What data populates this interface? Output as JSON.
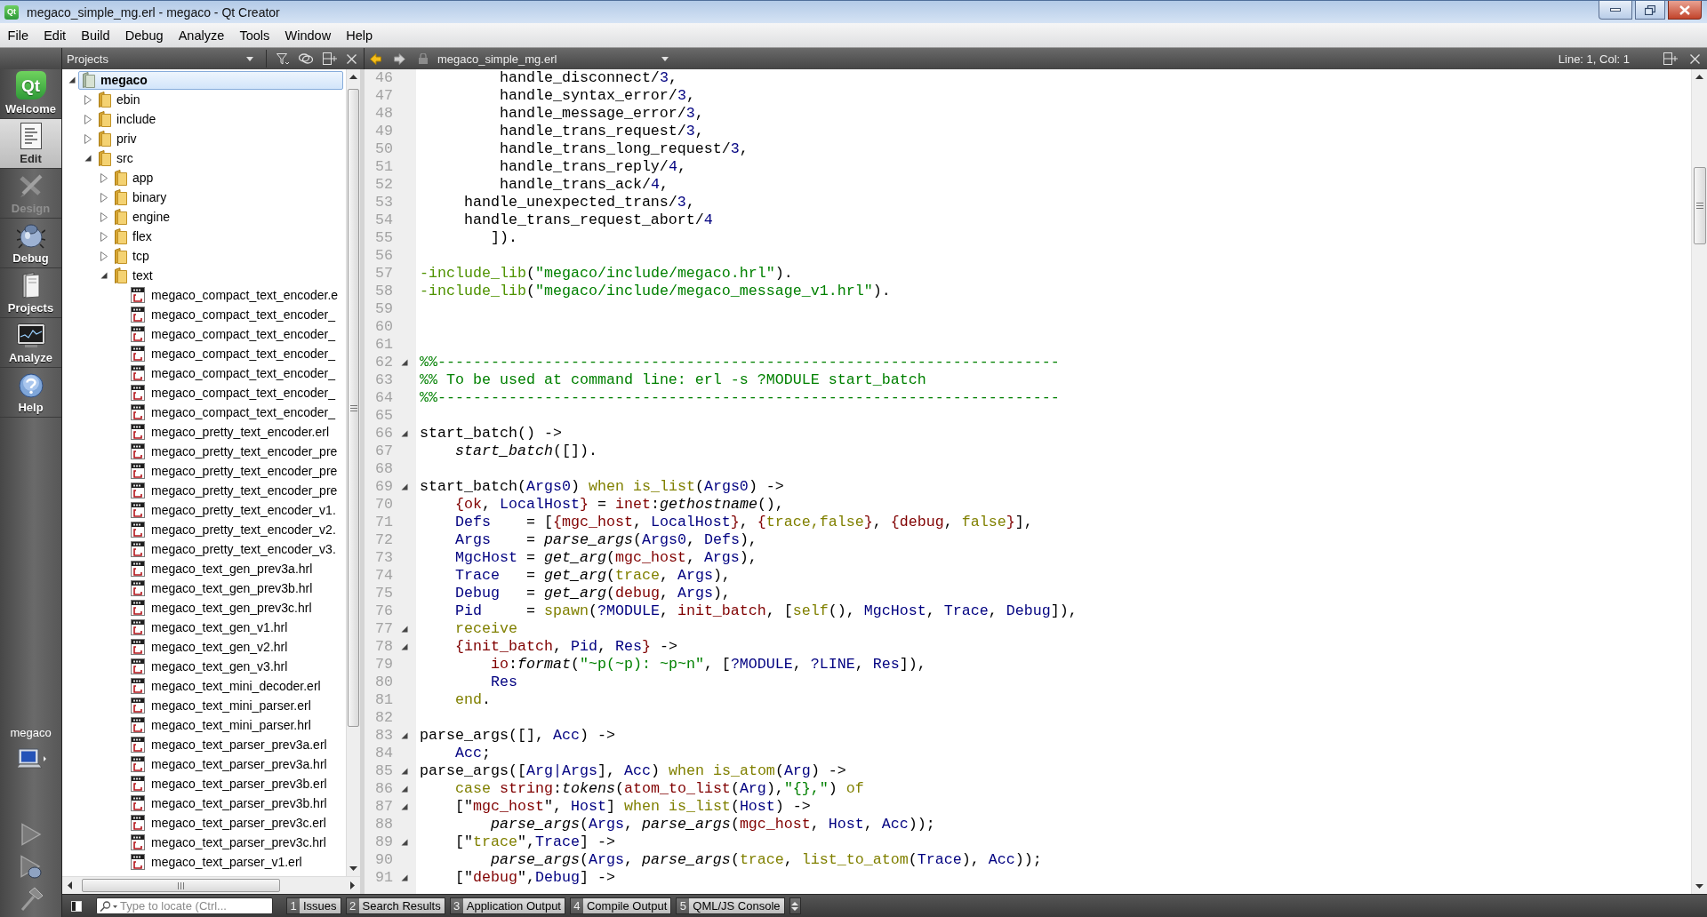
{
  "window": {
    "icon_text": "Qt",
    "title": "megaco_simple_mg.erl - megaco - Qt Creator"
  },
  "menu": [
    "File",
    "Edit",
    "Build",
    "Debug",
    "Analyze",
    "Tools",
    "Window",
    "Help"
  ],
  "modes": [
    {
      "kind": "welcome",
      "label": "Welcome",
      "logo_text": "Qt",
      "selected": false,
      "disabled": false
    },
    {
      "kind": "edit",
      "label": "Edit",
      "selected": true,
      "disabled": false
    },
    {
      "kind": "design",
      "label": "Design",
      "selected": false,
      "disabled": true
    },
    {
      "kind": "debug",
      "label": "Debug",
      "selected": false,
      "disabled": false
    },
    {
      "kind": "projects",
      "label": "Projects",
      "selected": false,
      "disabled": false
    },
    {
      "kind": "analyze",
      "label": "Analyze",
      "selected": false,
      "disabled": false
    },
    {
      "kind": "help",
      "label": "Help",
      "selected": false,
      "disabled": false
    }
  ],
  "target": {
    "label": "megaco"
  },
  "projects_panel": {
    "view": "Projects",
    "tree": [
      {
        "kind": "project",
        "label": "megaco",
        "selected": true,
        "expanded": true,
        "children": [
          {
            "kind": "folder",
            "label": "ebin",
            "selected": false,
            "expanded": false
          },
          {
            "kind": "folder",
            "label": "include",
            "selected": false,
            "expanded": false
          },
          {
            "kind": "folder",
            "label": "priv",
            "selected": false,
            "expanded": false
          },
          {
            "kind": "folder",
            "label": "src",
            "selected": false,
            "expanded": true,
            "children": [
              {
                "kind": "folder",
                "label": "app",
                "selected": false,
                "expanded": false
              },
              {
                "kind": "folder",
                "label": "binary",
                "selected": false,
                "expanded": false
              },
              {
                "kind": "folder",
                "label": "engine",
                "selected": false,
                "expanded": false
              },
              {
                "kind": "folder",
                "label": "flex",
                "selected": false,
                "expanded": false
              },
              {
                "kind": "folder",
                "label": "tcp",
                "selected": false,
                "expanded": false
              },
              {
                "kind": "folder",
                "label": "text",
                "selected": false,
                "expanded": true,
                "children": [
                  {
                    "kind": "file",
                    "label": "megaco_compact_text_encoder.e",
                    "selected": false
                  },
                  {
                    "kind": "file",
                    "label": "megaco_compact_text_encoder_",
                    "selected": false
                  },
                  {
                    "kind": "file",
                    "label": "megaco_compact_text_encoder_",
                    "selected": false
                  },
                  {
                    "kind": "file",
                    "label": "megaco_compact_text_encoder_",
                    "selected": false
                  },
                  {
                    "kind": "file",
                    "label": "megaco_compact_text_encoder_",
                    "selected": false
                  },
                  {
                    "kind": "file",
                    "label": "megaco_compact_text_encoder_",
                    "selected": false
                  },
                  {
                    "kind": "file",
                    "label": "megaco_compact_text_encoder_",
                    "selected": false
                  },
                  {
                    "kind": "file",
                    "label": "megaco_pretty_text_encoder.erl",
                    "selected": false
                  },
                  {
                    "kind": "file",
                    "label": "megaco_pretty_text_encoder_pre",
                    "selected": false
                  },
                  {
                    "kind": "file",
                    "label": "megaco_pretty_text_encoder_pre",
                    "selected": false
                  },
                  {
                    "kind": "file",
                    "label": "megaco_pretty_text_encoder_pre",
                    "selected": false
                  },
                  {
                    "kind": "file",
                    "label": "megaco_pretty_text_encoder_v1.",
                    "selected": false
                  },
                  {
                    "kind": "file",
                    "label": "megaco_pretty_text_encoder_v2.",
                    "selected": false
                  },
                  {
                    "kind": "file",
                    "label": "megaco_pretty_text_encoder_v3.",
                    "selected": false
                  },
                  {
                    "kind": "file",
                    "label": "megaco_text_gen_prev3a.hrl",
                    "selected": false
                  },
                  {
                    "kind": "file",
                    "label": "megaco_text_gen_prev3b.hrl",
                    "selected": false
                  },
                  {
                    "kind": "file",
                    "label": "megaco_text_gen_prev3c.hrl",
                    "selected": false
                  },
                  {
                    "kind": "file",
                    "label": "megaco_text_gen_v1.hrl",
                    "selected": false
                  },
                  {
                    "kind": "file",
                    "label": "megaco_text_gen_v2.hrl",
                    "selected": false
                  },
                  {
                    "kind": "file",
                    "label": "megaco_text_gen_v3.hrl",
                    "selected": false
                  },
                  {
                    "kind": "file",
                    "label": "megaco_text_mini_decoder.erl",
                    "selected": false
                  },
                  {
                    "kind": "file",
                    "label": "megaco_text_mini_parser.erl",
                    "selected": false
                  },
                  {
                    "kind": "file",
                    "label": "megaco_text_mini_parser.hrl",
                    "selected": false
                  },
                  {
                    "kind": "file",
                    "label": "megaco_text_parser_prev3a.erl",
                    "selected": false
                  },
                  {
                    "kind": "file",
                    "label": "megaco_text_parser_prev3a.hrl",
                    "selected": false
                  },
                  {
                    "kind": "file",
                    "label": "megaco_text_parser_prev3b.erl",
                    "selected": false
                  },
                  {
                    "kind": "file",
                    "label": "megaco_text_parser_prev3b.hrl",
                    "selected": false
                  },
                  {
                    "kind": "file",
                    "label": "megaco_text_parser_prev3c.erl",
                    "selected": false
                  },
                  {
                    "kind": "file",
                    "label": "megaco_text_parser_prev3c.hrl",
                    "selected": false
                  },
                  {
                    "kind": "file",
                    "label": "megaco_text_parser_v1.erl",
                    "selected": false
                  }
                ]
              }
            ]
          }
        ]
      }
    ]
  },
  "editor": {
    "file": "megaco_simple_mg.erl",
    "cursor_position": "Line: 1, Col: 1",
    "lines": [
      {
        "number": "46",
        "foldable": false,
        "tokens": [
          {
            "kind": "plain",
            "text": "         handle_disconnect/"
          },
          {
            "kind": "number",
            "text": "3"
          },
          {
            "kind": "plain",
            "text": ","
          }
        ]
      },
      {
        "number": "47",
        "foldable": false,
        "tokens": [
          {
            "kind": "plain",
            "text": "         handle_syntax_error/"
          },
          {
            "kind": "number",
            "text": "3"
          },
          {
            "kind": "plain",
            "text": ","
          }
        ]
      },
      {
        "number": "48",
        "foldable": false,
        "tokens": [
          {
            "kind": "plain",
            "text": "         handle_message_error/"
          },
          {
            "kind": "number",
            "text": "3"
          },
          {
            "kind": "plain",
            "text": ","
          }
        ]
      },
      {
        "number": "49",
        "foldable": false,
        "tokens": [
          {
            "kind": "plain",
            "text": "         handle_trans_request/"
          },
          {
            "kind": "number",
            "text": "3"
          },
          {
            "kind": "plain",
            "text": ","
          }
        ]
      },
      {
        "number": "50",
        "foldable": false,
        "tokens": [
          {
            "kind": "plain",
            "text": "         handle_trans_long_request/"
          },
          {
            "kind": "number",
            "text": "3"
          },
          {
            "kind": "plain",
            "text": ","
          }
        ]
      },
      {
        "number": "51",
        "foldable": false,
        "tokens": [
          {
            "kind": "plain",
            "text": "         handle_trans_reply/"
          },
          {
            "kind": "number",
            "text": "4"
          },
          {
            "kind": "plain",
            "text": ","
          }
        ]
      },
      {
        "number": "52",
        "foldable": false,
        "tokens": [
          {
            "kind": "plain",
            "text": "         handle_trans_ack/"
          },
          {
            "kind": "number",
            "text": "4"
          },
          {
            "kind": "plain",
            "text": ","
          }
        ]
      },
      {
        "number": "53",
        "foldable": false,
        "tokens": [
          {
            "kind": "plain",
            "text": "     handle_unexpected_trans/"
          },
          {
            "kind": "number",
            "text": "3"
          },
          {
            "kind": "plain",
            "text": ","
          }
        ]
      },
      {
        "number": "54",
        "foldable": false,
        "tokens": [
          {
            "kind": "plain",
            "text": "     handle_trans_request_abort/"
          },
          {
            "kind": "number",
            "text": "4"
          }
        ]
      },
      {
        "number": "55",
        "foldable": false,
        "tokens": [
          {
            "kind": "plain",
            "text": "        ])."
          }
        ]
      },
      {
        "number": "56",
        "foldable": false
      },
      {
        "number": "57",
        "foldable": false,
        "tokens": [
          {
            "kind": "directive",
            "text": "-include_lib"
          },
          {
            "kind": "plain",
            "text": "("
          },
          {
            "kind": "string",
            "text": "\"megaco/include/megaco.hrl\""
          },
          {
            "kind": "plain",
            "text": ")."
          }
        ]
      },
      {
        "number": "58",
        "foldable": false,
        "tokens": [
          {
            "kind": "directive",
            "text": "-include_lib"
          },
          {
            "kind": "plain",
            "text": "("
          },
          {
            "kind": "string",
            "text": "\"megaco/include/megaco_message_v1.hrl\""
          },
          {
            "kind": "plain",
            "text": ")."
          }
        ]
      },
      {
        "number": "59",
        "foldable": false
      },
      {
        "number": "60",
        "foldable": false
      },
      {
        "number": "61",
        "foldable": false
      },
      {
        "number": "62",
        "foldable": true,
        "tokens": [
          {
            "kind": "comment",
            "text": "%%----------------------------------------------------------------------"
          }
        ]
      },
      {
        "number": "63",
        "foldable": false,
        "tokens": [
          {
            "kind": "comment",
            "text": "%% To be used at command line: erl -s ?MODULE start_batch"
          }
        ]
      },
      {
        "number": "64",
        "foldable": false,
        "tokens": [
          {
            "kind": "comment",
            "text": "%%----------------------------------------------------------------------"
          }
        ]
      },
      {
        "number": "65",
        "foldable": false
      },
      {
        "number": "66",
        "foldable": true,
        "tokens": [
          {
            "kind": "plain",
            "text": "start_batch() ->"
          }
        ]
      },
      {
        "number": "67",
        "foldable": false,
        "tokens": [
          {
            "kind": "call",
            "text": "    start_batch"
          },
          {
            "kind": "plain",
            "text": "([])."
          }
        ]
      },
      {
        "number": "68",
        "foldable": false
      },
      {
        "number": "69",
        "foldable": true,
        "tokens": [
          {
            "kind": "plain",
            "text": "start_batch("
          },
          {
            "kind": "variable",
            "text": "Args0"
          },
          {
            "kind": "plain",
            "text": ") "
          },
          {
            "kind": "keyword",
            "text": "when is_list"
          },
          {
            "kind": "plain",
            "text": "("
          },
          {
            "kind": "variable",
            "text": "Args0"
          },
          {
            "kind": "plain",
            "text": ") ->"
          }
        ]
      },
      {
        "number": "70",
        "foldable": false,
        "tokens": [
          {
            "kind": "atom",
            "text": "    {ok"
          },
          {
            "kind": "plain",
            "text": ", "
          },
          {
            "kind": "variable",
            "text": "LocalHost"
          },
          {
            "kind": "atom",
            "text": "}"
          },
          {
            "kind": "plain",
            "text": " = "
          },
          {
            "kind": "atom",
            "text": "inet"
          },
          {
            "kind": "plain",
            "text": ":"
          },
          {
            "kind": "call",
            "text": "gethostname"
          },
          {
            "kind": "plain",
            "text": "(),"
          }
        ]
      },
      {
        "number": "71",
        "foldable": false,
        "tokens": [
          {
            "kind": "variable",
            "text": "    Defs"
          },
          {
            "kind": "plain",
            "text": "    = ["
          },
          {
            "kind": "atom",
            "text": "{mgc_host"
          },
          {
            "kind": "plain",
            "text": ", "
          },
          {
            "kind": "variable",
            "text": "LocalHost"
          },
          {
            "kind": "atom",
            "text": "}"
          },
          {
            "kind": "plain",
            "text": ", "
          },
          {
            "kind": "atom",
            "text": "{"
          },
          {
            "kind": "keyword",
            "text": "trace,false"
          },
          {
            "kind": "atom",
            "text": "}"
          },
          {
            "kind": "plain",
            "text": ", "
          },
          {
            "kind": "atom",
            "text": "{debug"
          },
          {
            "kind": "plain",
            "text": ", "
          },
          {
            "kind": "keyword",
            "text": "false"
          },
          {
            "kind": "atom",
            "text": "}"
          },
          {
            "kind": "plain",
            "text": "],"
          }
        ]
      },
      {
        "number": "72",
        "foldable": false,
        "tokens": [
          {
            "kind": "variable",
            "text": "    Args"
          },
          {
            "kind": "plain",
            "text": "    = "
          },
          {
            "kind": "call",
            "text": "parse_args"
          },
          {
            "kind": "plain",
            "text": "("
          },
          {
            "kind": "variable",
            "text": "Args0"
          },
          {
            "kind": "plain",
            "text": ", "
          },
          {
            "kind": "variable",
            "text": "Defs"
          },
          {
            "kind": "plain",
            "text": "),"
          }
        ]
      },
      {
        "number": "73",
        "foldable": false,
        "tokens": [
          {
            "kind": "variable",
            "text": "    MgcHost"
          },
          {
            "kind": "plain",
            "text": " = "
          },
          {
            "kind": "call",
            "text": "get_arg"
          },
          {
            "kind": "plain",
            "text": "("
          },
          {
            "kind": "atom",
            "text": "mgc_host"
          },
          {
            "kind": "plain",
            "text": ", "
          },
          {
            "kind": "variable",
            "text": "Args"
          },
          {
            "kind": "plain",
            "text": "),"
          }
        ]
      },
      {
        "number": "74",
        "foldable": false,
        "tokens": [
          {
            "kind": "variable",
            "text": "    Trace"
          },
          {
            "kind": "plain",
            "text": "   = "
          },
          {
            "kind": "call",
            "text": "get_arg"
          },
          {
            "kind": "plain",
            "text": "("
          },
          {
            "kind": "keyword",
            "text": "trace"
          },
          {
            "kind": "plain",
            "text": ", "
          },
          {
            "kind": "variable",
            "text": "Args"
          },
          {
            "kind": "plain",
            "text": "),"
          }
        ]
      },
      {
        "number": "75",
        "foldable": false,
        "tokens": [
          {
            "kind": "variable",
            "text": "    Debug"
          },
          {
            "kind": "plain",
            "text": "   = "
          },
          {
            "kind": "call",
            "text": "get_arg"
          },
          {
            "kind": "plain",
            "text": "("
          },
          {
            "kind": "atom",
            "text": "debug"
          },
          {
            "kind": "plain",
            "text": ", "
          },
          {
            "kind": "variable",
            "text": "Args"
          },
          {
            "kind": "plain",
            "text": "),"
          }
        ]
      },
      {
        "number": "76",
        "foldable": false,
        "tokens": [
          {
            "kind": "variable",
            "text": "    Pid"
          },
          {
            "kind": "plain",
            "text": "     = "
          },
          {
            "kind": "keyword",
            "text": "spawn"
          },
          {
            "kind": "plain",
            "text": "("
          },
          {
            "kind": "variable",
            "text": "?MODULE"
          },
          {
            "kind": "plain",
            "text": ", "
          },
          {
            "kind": "atom",
            "text": "init_batch"
          },
          {
            "kind": "plain",
            "text": ", ["
          },
          {
            "kind": "keyword",
            "text": "self"
          },
          {
            "kind": "plain",
            "text": "(), "
          },
          {
            "kind": "variable",
            "text": "MgcHost"
          },
          {
            "kind": "plain",
            "text": ", "
          },
          {
            "kind": "variable",
            "text": "Trace"
          },
          {
            "kind": "plain",
            "text": ", "
          },
          {
            "kind": "variable",
            "text": "Debug"
          },
          {
            "kind": "plain",
            "text": "]),"
          }
        ]
      },
      {
        "number": "77",
        "foldable": true,
        "tokens": [
          {
            "kind": "keyword",
            "text": "    receive"
          }
        ]
      },
      {
        "number": "78",
        "foldable": true,
        "tokens": [
          {
            "kind": "atom",
            "text": "    {init_batch"
          },
          {
            "kind": "plain",
            "text": ", "
          },
          {
            "kind": "variable",
            "text": "Pid"
          },
          {
            "kind": "plain",
            "text": ", "
          },
          {
            "kind": "variable",
            "text": "Res"
          },
          {
            "kind": "atom",
            "text": "}"
          },
          {
            "kind": "plain",
            "text": " ->"
          }
        ]
      },
      {
        "number": "79",
        "foldable": false,
        "tokens": [
          {
            "kind": "atom",
            "text": "        io"
          },
          {
            "kind": "plain",
            "text": ":"
          },
          {
            "kind": "call",
            "text": "format"
          },
          {
            "kind": "plain",
            "text": "("
          },
          {
            "kind": "string",
            "text": "\"~p(~p): ~p~n\""
          },
          {
            "kind": "plain",
            "text": ", ["
          },
          {
            "kind": "variable",
            "text": "?MODULE"
          },
          {
            "kind": "plain",
            "text": ", "
          },
          {
            "kind": "variable",
            "text": "?LINE"
          },
          {
            "kind": "plain",
            "text": ", "
          },
          {
            "kind": "variable",
            "text": "Res"
          },
          {
            "kind": "plain",
            "text": "]),"
          }
        ]
      },
      {
        "number": "80",
        "foldable": false,
        "tokens": [
          {
            "kind": "variable",
            "text": "        Res"
          }
        ]
      },
      {
        "number": "81",
        "foldable": false,
        "tokens": [
          {
            "kind": "keyword",
            "text": "    end"
          },
          {
            "kind": "plain",
            "text": "."
          }
        ]
      },
      {
        "number": "82",
        "foldable": false
      },
      {
        "number": "83",
        "foldable": true,
        "tokens": [
          {
            "kind": "plain",
            "text": "parse_args([], "
          },
          {
            "kind": "variable",
            "text": "Acc"
          },
          {
            "kind": "plain",
            "text": ") ->"
          }
        ]
      },
      {
        "number": "84",
        "foldable": false,
        "tokens": [
          {
            "kind": "variable",
            "text": "    Acc"
          },
          {
            "kind": "plain",
            "text": ";"
          }
        ]
      },
      {
        "number": "85",
        "foldable": true,
        "tokens": [
          {
            "kind": "plain",
            "text": "parse_args(["
          },
          {
            "kind": "variable",
            "text": "Arg|Args"
          },
          {
            "kind": "plain",
            "text": "], "
          },
          {
            "kind": "variable",
            "text": "Acc"
          },
          {
            "kind": "plain",
            "text": ") "
          },
          {
            "kind": "keyword",
            "text": "when is_atom"
          },
          {
            "kind": "plain",
            "text": "("
          },
          {
            "kind": "variable",
            "text": "Arg"
          },
          {
            "kind": "plain",
            "text": ") ->"
          }
        ]
      },
      {
        "number": "86",
        "foldable": true,
        "tokens": [
          {
            "kind": "keyword",
            "text": "    case "
          },
          {
            "kind": "atom",
            "text": "string"
          },
          {
            "kind": "plain",
            "text": ":"
          },
          {
            "kind": "call",
            "text": "tokens"
          },
          {
            "kind": "plain",
            "text": "("
          },
          {
            "kind": "atom",
            "text": "atom_to_list"
          },
          {
            "kind": "plain",
            "text": "("
          },
          {
            "kind": "variable",
            "text": "Arg"
          },
          {
            "kind": "plain",
            "text": "),"
          },
          {
            "kind": "string",
            "text": "\"{},\""
          },
          {
            "kind": "plain",
            "text": ") "
          },
          {
            "kind": "keyword",
            "text": "of"
          }
        ]
      },
      {
        "number": "87",
        "foldable": true,
        "tokens": [
          {
            "kind": "plain",
            "text": "    [\""
          },
          {
            "kind": "atom",
            "text": "mgc_host"
          },
          {
            "kind": "plain",
            "text": "\", "
          },
          {
            "kind": "variable",
            "text": "Host"
          },
          {
            "kind": "plain",
            "text": "] "
          },
          {
            "kind": "keyword",
            "text": "when is_list"
          },
          {
            "kind": "plain",
            "text": "("
          },
          {
            "kind": "variable",
            "text": "Host"
          },
          {
            "kind": "plain",
            "text": ") ->"
          }
        ]
      },
      {
        "number": "88",
        "foldable": false,
        "tokens": [
          {
            "kind": "call",
            "text": "        parse_args"
          },
          {
            "kind": "plain",
            "text": "("
          },
          {
            "kind": "variable",
            "text": "Args"
          },
          {
            "kind": "plain",
            "text": ", "
          },
          {
            "kind": "call",
            "text": "parse_args"
          },
          {
            "kind": "plain",
            "text": "("
          },
          {
            "kind": "atom",
            "text": "mgc_host"
          },
          {
            "kind": "plain",
            "text": ", "
          },
          {
            "kind": "variable",
            "text": "Host"
          },
          {
            "kind": "plain",
            "text": ", "
          },
          {
            "kind": "variable",
            "text": "Acc"
          },
          {
            "kind": "plain",
            "text": "));"
          }
        ]
      },
      {
        "number": "89",
        "foldable": true,
        "tokens": [
          {
            "kind": "plain",
            "text": "    [\""
          },
          {
            "kind": "keyword",
            "text": "trace"
          },
          {
            "kind": "plain",
            "text": "\","
          },
          {
            "kind": "variable",
            "text": "Trace"
          },
          {
            "kind": "plain",
            "text": "] ->"
          }
        ]
      },
      {
        "number": "90",
        "foldable": false,
        "tokens": [
          {
            "kind": "call",
            "text": "        parse_args"
          },
          {
            "kind": "plain",
            "text": "("
          },
          {
            "kind": "variable",
            "text": "Args"
          },
          {
            "kind": "plain",
            "text": ", "
          },
          {
            "kind": "call",
            "text": "parse_args"
          },
          {
            "kind": "plain",
            "text": "("
          },
          {
            "kind": "keyword",
            "text": "trace"
          },
          {
            "kind": "plain",
            "text": ", "
          },
          {
            "kind": "keyword",
            "text": "list_to_atom"
          },
          {
            "kind": "plain",
            "text": "("
          },
          {
            "kind": "variable",
            "text": "Trace"
          },
          {
            "kind": "plain",
            "text": "), "
          },
          {
            "kind": "variable",
            "text": "Acc"
          },
          {
            "kind": "plain",
            "text": "));"
          }
        ]
      },
      {
        "number": "91",
        "foldable": true,
        "tokens": [
          {
            "kind": "plain",
            "text": "    [\""
          },
          {
            "kind": "atom",
            "text": "debug"
          },
          {
            "kind": "plain",
            "text": "\","
          },
          {
            "kind": "variable",
            "text": "Debug"
          },
          {
            "kind": "plain",
            "text": "] ->"
          }
        ]
      }
    ]
  },
  "bottom_bar": {
    "locate": {
      "placeholder": "Type to locate (Ctrl..."
    },
    "panes": [
      {
        "number": "1",
        "label": "Issues"
      },
      {
        "number": "2",
        "label": "Search Results"
      },
      {
        "number": "3",
        "label": "Application Output"
      },
      {
        "number": "4",
        "label": "Compile Output"
      },
      {
        "number": "5",
        "label": "QML/JS Console"
      }
    ]
  }
}
